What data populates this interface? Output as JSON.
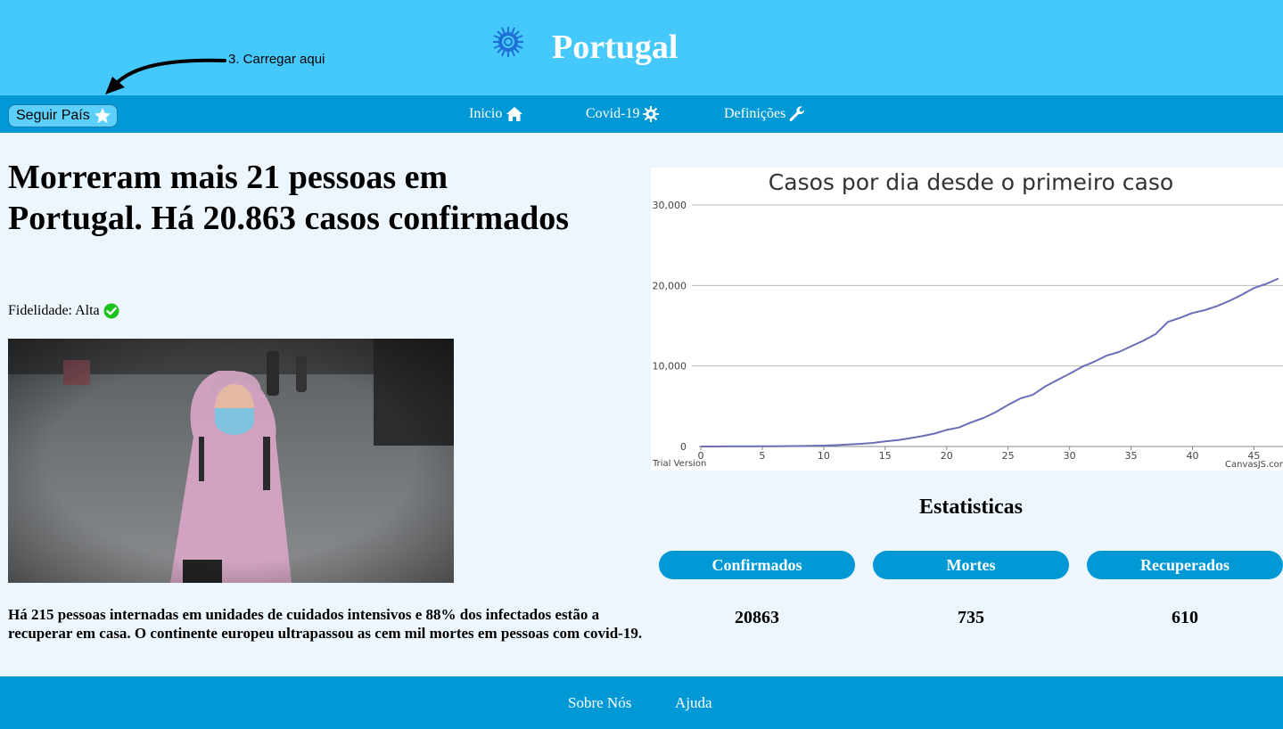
{
  "header": {
    "title": "Portugal",
    "logo_icon": "virus-logo-icon",
    "annotation": "3. Carregar aqui"
  },
  "nav": {
    "follow_button": "Seguir País",
    "follow_icon": "star-icon",
    "items": [
      {
        "label": "Inicio",
        "icon": "home-icon"
      },
      {
        "label": "Covid-19",
        "icon": "virus-icon"
      },
      {
        "label": "Definições",
        "icon": "wrench-icon"
      }
    ]
  },
  "article": {
    "headline": "Morreram mais 21 pessoas em Portugal. Há 20.863 casos confirmados",
    "fidelity": "Fidelidade: Alta",
    "fidelity_icon": "check-circle-icon",
    "summary": "Há 215 pessoas internadas em unidades de cuidados intensivos e 88% dos infectados estão a recuperar em casa. O continente europeu ultrapassou as cem mil mortes em pessoas com covid-19."
  },
  "chart_data": {
    "type": "line",
    "title": "Casos por dia desde o primeiro caso",
    "xlabel": "",
    "ylabel": "",
    "x_ticks": [
      0,
      5,
      10,
      15,
      20,
      25,
      30,
      35,
      40,
      45
    ],
    "y_ticks": [
      0,
      10000,
      20000,
      30000
    ],
    "y_tick_labels": [
      "0",
      "10,000",
      "20,000",
      "30,000"
    ],
    "xlim": [
      0,
      47
    ],
    "ylim": [
      0,
      30000
    ],
    "grid": true,
    "color": "#6b6db6",
    "x": [
      0,
      1,
      2,
      3,
      4,
      5,
      6,
      7,
      8,
      9,
      10,
      11,
      12,
      13,
      14,
      15,
      16,
      17,
      18,
      19,
      20,
      21,
      22,
      23,
      24,
      25,
      26,
      27,
      28,
      29,
      30,
      31,
      32,
      33,
      34,
      35,
      36,
      37,
      38,
      39,
      40,
      41,
      42,
      43,
      44,
      45,
      46,
      47
    ],
    "y": [
      2,
      4,
      6,
      9,
      13,
      21,
      30,
      41,
      59,
      78,
      112,
      169,
      245,
      331,
      448,
      642,
      785,
      1020,
      1280,
      1600,
      2060,
      2362,
      2995,
      3544,
      4268,
      5170,
      5962,
      6408,
      7443,
      8251,
      9034,
      9886,
      10524,
      11278,
      11730,
      12442,
      13141,
      13956,
      15472,
      15987,
      16585,
      16934,
      17448,
      18091,
      18841,
      19685,
      20206,
      20863
    ],
    "trial_text": "Trial Version",
    "credit_text": "CanvasJS.com"
  },
  "stats": {
    "title": "Estatisticas",
    "items": [
      {
        "label": "Confirmados",
        "value": "20863"
      },
      {
        "label": "Mortes",
        "value": "735"
      },
      {
        "label": "Recuperados",
        "value": "610"
      }
    ]
  },
  "footer": {
    "links": [
      "Sobre Nós",
      "Ajuda"
    ]
  }
}
